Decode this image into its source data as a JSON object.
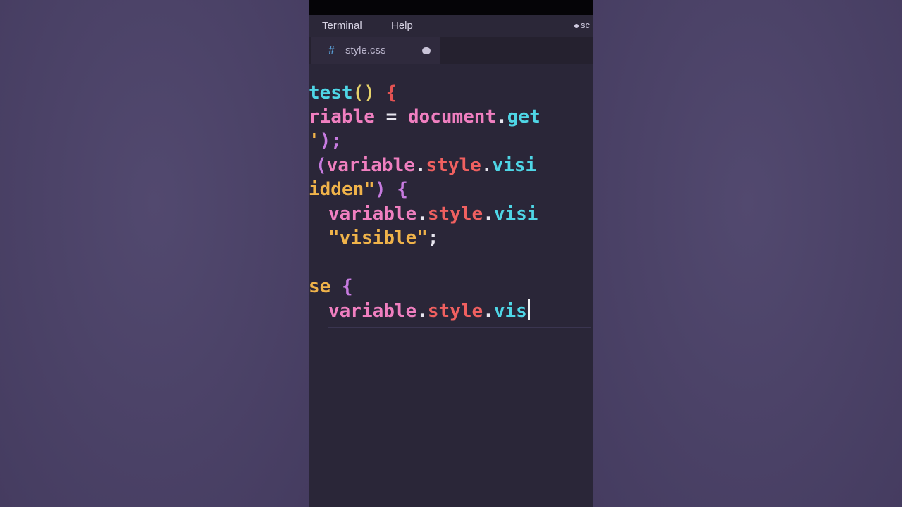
{
  "menubar": {
    "items": [
      "Terminal",
      "Help"
    ],
    "right_text": "sc"
  },
  "tab": {
    "icon": "#",
    "name": "style.css"
  },
  "code": {
    "line1": {
      "a": "test",
      "b": "()",
      "c": " {"
    },
    "line2": {
      "a": "riable",
      "b": " = ",
      "c": "document",
      "d": ".",
      "e": "get"
    },
    "line3": {
      "a": "'",
      "b": ");"
    },
    "line4": {
      "a": "(",
      "b": "variable",
      "c": ".",
      "d": "style",
      "e": ".",
      "f": "visi"
    },
    "line5": {
      "a": "idden\"",
      "b": ")",
      "c": " {"
    },
    "line6": {
      "a": "variable",
      "b": ".",
      "c": "style",
      "d": ".",
      "e": "visi"
    },
    "line7": {
      "a": "\"visible\"",
      "b": ";"
    },
    "line8": {
      "a": "se",
      "b": " {"
    },
    "line9": {
      "a": "variable",
      "b": ".",
      "c": "style",
      "d": ".",
      "e": "vis"
    }
  },
  "colors": {
    "function": "#4fd6e6",
    "variable": "#f07fc0",
    "string": "#f0b34a",
    "property": "#f06060"
  }
}
